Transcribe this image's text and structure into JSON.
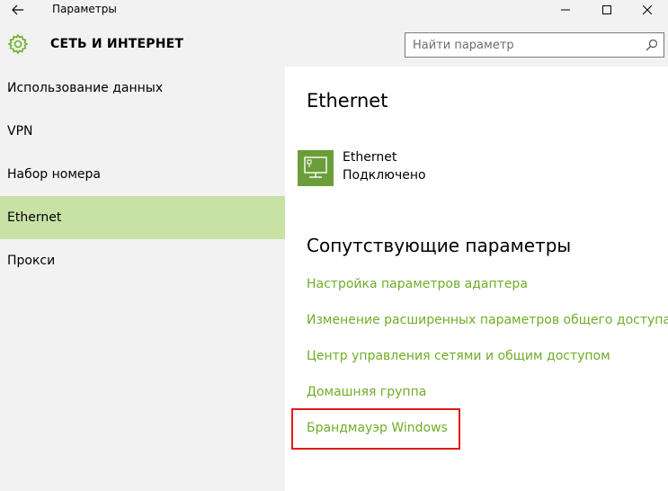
{
  "window": {
    "title": "Параметры",
    "icons": {
      "back": "back-arrow-icon",
      "minimize": "minimize-icon",
      "maximize": "maximize-icon",
      "close": "close-icon"
    }
  },
  "header": {
    "icon": "gear-icon",
    "title": "СЕТЬ И ИНТЕРНЕТ",
    "search": {
      "placeholder": "Найти параметр",
      "value": "",
      "icon": "search-icon"
    }
  },
  "sidebar": {
    "selected_index": 3,
    "items": [
      {
        "label": "Использование данных"
      },
      {
        "label": "VPN"
      },
      {
        "label": "Набор номера"
      },
      {
        "label": "Ethernet"
      },
      {
        "label": "Прокси"
      }
    ]
  },
  "main": {
    "title": "Ethernet",
    "connection": {
      "icon": "ethernet-monitor-icon",
      "name": "Ethernet",
      "status": "Подключено"
    },
    "related_title": "Сопутствующие параметры",
    "links": [
      {
        "label": "Настройка параметров адаптера"
      },
      {
        "label": "Изменение расширенных параметров общего доступа"
      },
      {
        "label": "Центр управления сетями и общим доступом"
      },
      {
        "label": "Домашняя группа"
      },
      {
        "label": "Брандмауэр Windows"
      }
    ],
    "highlighted_link_index": 4
  },
  "colors": {
    "accent": "#6fad28",
    "selection": "#c8e1a5",
    "tile": "#6b9e3b",
    "highlight_border": "#e31b1b"
  }
}
